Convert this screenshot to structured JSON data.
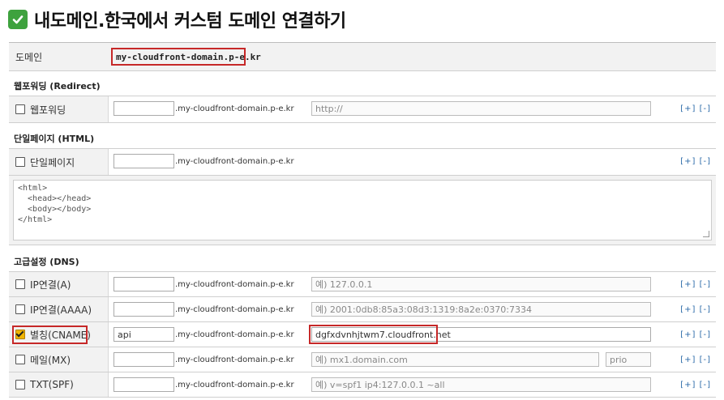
{
  "page": {
    "title": "내도메인.한국에서 커스텀 도메인 연결하기",
    "domain_label": "도메인",
    "domain_value": "my-cloudfront-domain.p-e.kr"
  },
  "forwarding": {
    "section_title": "웹포워딩 (Redirect)",
    "row_label": "웹포워딩",
    "suffix": ".my-cloudfront-domain.p-e.kr",
    "url_placeholder": "http://",
    "controls": "[+] [-]"
  },
  "single_page": {
    "section_title": "단일페이지 (HTML)",
    "row_label": "단일페이지",
    "suffix": ".my-cloudfront-domain.p-e.kr",
    "controls": "[+] [-]",
    "html_content": "<html>\n  <head></head>\n  <body></body>\n</html>"
  },
  "dns": {
    "section_title": "고급설정 (DNS)",
    "suffix": ".my-cloudfront-domain.p-e.kr",
    "controls": "[+] [-]",
    "rows": [
      {
        "label": "IP연결(A)",
        "checked": false,
        "host": "",
        "value": "",
        "placeholder": "예) 127.0.0.1"
      },
      {
        "label": "IP연결(AAAA)",
        "checked": false,
        "host": "",
        "value": "",
        "placeholder": "예) 2001:0db8:85a3:08d3:1319:8a2e:0370:7334"
      },
      {
        "label": "별칭(CNAME)",
        "checked": true,
        "host": "api",
        "value": "dgfxdvnhjtwm7.cloudfront.net",
        "placeholder": ""
      },
      {
        "label": "메일(MX)",
        "checked": false,
        "host": "",
        "value": "",
        "placeholder": "예) mx1.domain.com",
        "prio_placeholder": "prio"
      },
      {
        "label": "TXT(SPF)",
        "checked": false,
        "host": "",
        "value": "",
        "placeholder": "예) v=spf1 ip4:127.0.0.1 ~all"
      }
    ]
  },
  "colors": {
    "highlight_red": "#c62828",
    "check_green": "#3ea23e",
    "checkbox_checked": "#f0b400",
    "link_blue": "#2b6aa8"
  }
}
